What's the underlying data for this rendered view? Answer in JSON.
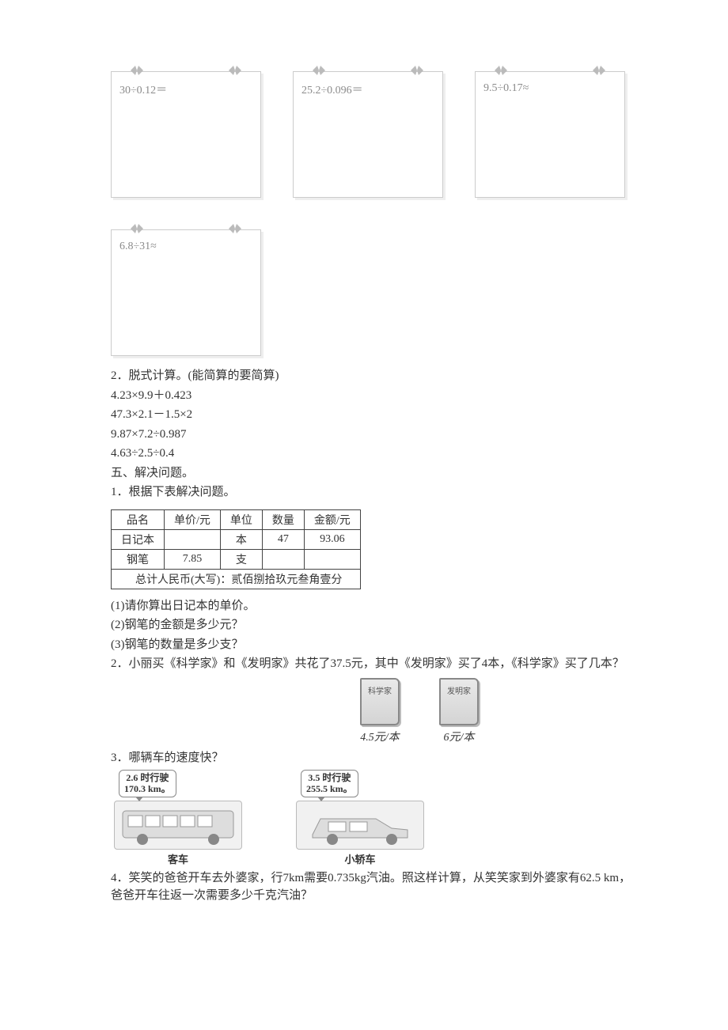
{
  "calc_cards": [
    {
      "expr": "30÷0.12＝"
    },
    {
      "expr": "25.2÷0.096＝"
    },
    {
      "expr": "9.5÷0.17≈"
    },
    {
      "expr": "6.8÷31≈"
    }
  ],
  "section2": {
    "title": "2．脱式计算。(能简算的要简算)",
    "items": [
      "4.23×9.9＋0.423",
      "47.3×2.1－1.5×2",
      "9.87×7.2÷0.987",
      "4.63÷2.5÷0.4"
    ]
  },
  "section5": {
    "heading": "五、解决问题。",
    "q1": {
      "title": "1．根据下表解决问题。",
      "table": {
        "headers": [
          "品名",
          "单价/元",
          "单位",
          "数量",
          "金额/元"
        ],
        "rows": [
          [
            "日记本",
            "",
            "本",
            "47",
            "93.06"
          ],
          [
            "钢笔",
            "7.85",
            "支",
            "",
            ""
          ]
        ],
        "footer": "总计人民币(大写)：贰佰捌拾玖元叁角壹分"
      },
      "subs": [
        "(1)请你算出日记本的单价。",
        "(2)钢笔的金额是多少元？",
        "(3)钢笔的数量是多少支？"
      ]
    },
    "q2": {
      "text": "2．小丽买《科学家》和《发明家》共花了37.5元，其中《发明家》买了4本，《科学家》买了几本？",
      "books": [
        {
          "title": "科学家",
          "price": "4.5元/本"
        },
        {
          "title": "发明家",
          "price": "6元/本"
        }
      ]
    },
    "q3": {
      "text": "3．哪辆车的速度快？",
      "vehicles": [
        {
          "bubble_l1": "2.6 时行驶",
          "bubble_l2": "170.3 km。",
          "label": "客车"
        },
        {
          "bubble_l1": "3.5 时行驶",
          "bubble_l2": "255.5 km。",
          "label": "小轿车"
        }
      ]
    },
    "q4": {
      "text": "4．笑笑的爸爸开车去外婆家，行7km需要0.735kg汽油。照这样计算，从笑笑家到外婆家有62.5 km，爸爸开车往返一次需要多少千克汽油？"
    }
  }
}
